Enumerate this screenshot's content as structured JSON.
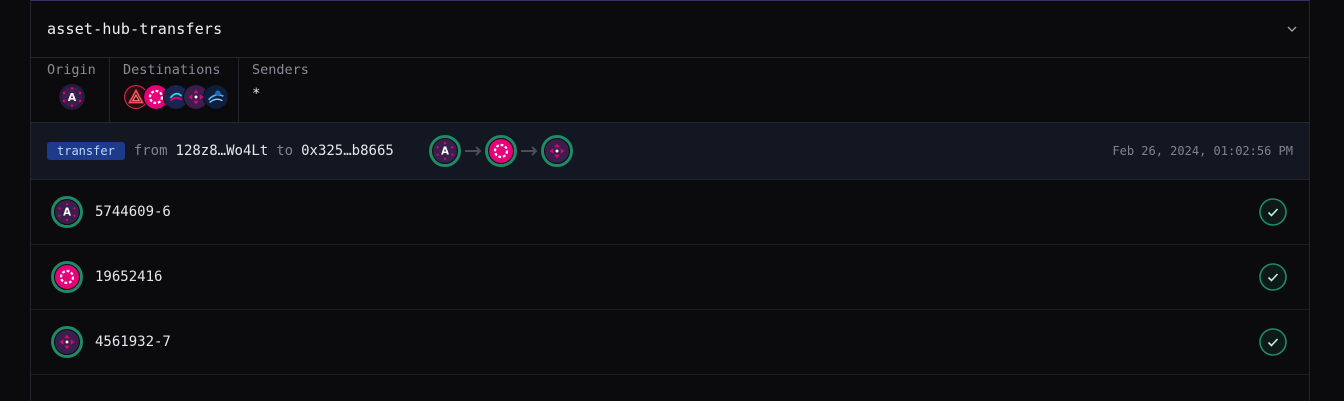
{
  "subscription": {
    "title": "asset-hub-transfers"
  },
  "meta": {
    "origin_label": "Origin",
    "destinations_label": "Destinations",
    "senders_label": "Senders",
    "senders_value": "*",
    "origin_icon": "assethub-icon",
    "destination_icons": [
      "acala-icon",
      "polkadot-icon",
      "astar-icon",
      "bifrost-icon",
      "moonbeam-icon"
    ]
  },
  "event": {
    "badge": "transfer",
    "from_word": "from",
    "from_addr": "128z8…Wo4Lt",
    "to_word": "to",
    "to_addr": "0x325…b8665",
    "timestamp": "Feb 26, 2024, 01:02:56 PM",
    "route_icons": [
      "assethub-icon",
      "polkadot-icon",
      "bifrost-icon"
    ]
  },
  "journey": [
    {
      "label": "5744609-6",
      "icon": "assethub-icon",
      "status": "success"
    },
    {
      "label": "19652416",
      "icon": "polkadot-icon",
      "status": "success"
    },
    {
      "label": "4561932-7",
      "icon": "bifrost-icon",
      "status": "success"
    }
  ],
  "colors": {
    "accent_pink": "#e6007a",
    "success_green": "#1f8a66",
    "badge_blue": "#1e3a8a",
    "event_bg": "#131722"
  }
}
